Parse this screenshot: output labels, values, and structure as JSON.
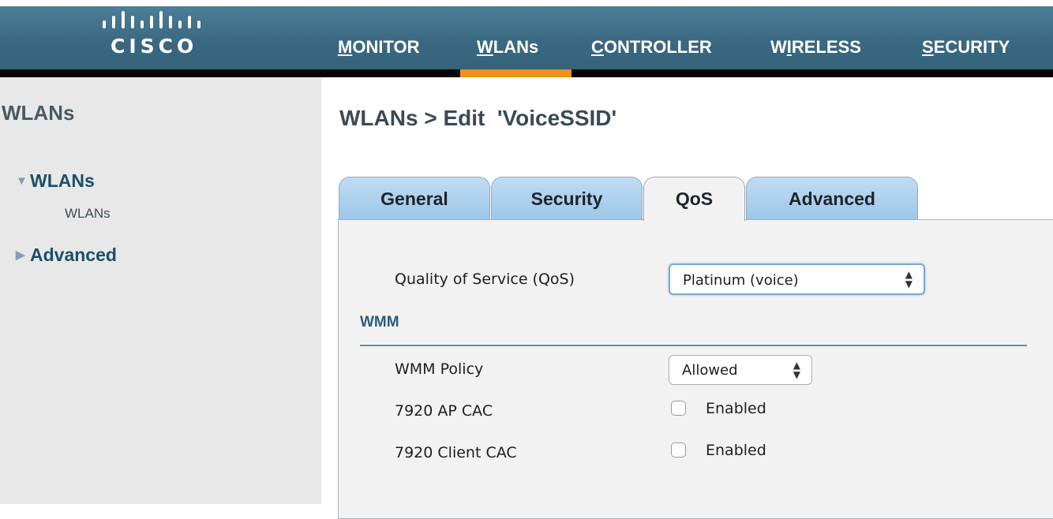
{
  "brand": {
    "logo_text": "CISCO"
  },
  "nav": {
    "monitor": {
      "ul": "M",
      "rest": "ONITOR"
    },
    "wlans": {
      "ul": "W",
      "rest": "LANs"
    },
    "controller": {
      "ul": "C",
      "rest": "ONTROLLER"
    },
    "wireless": {
      "pre": "W",
      "ul": "I",
      "rest": "RELESS"
    },
    "security": {
      "ul": "S",
      "rest": "ECURITY"
    },
    "active": "WLANs"
  },
  "sidebar": {
    "title": "WLANs",
    "items": [
      {
        "label": "WLANs",
        "expanded": true,
        "sub": "WLANs"
      },
      {
        "label": "Advanced",
        "expanded": false
      }
    ]
  },
  "page": {
    "title": "WLANs > Edit  'VoiceSSID'"
  },
  "tabs": [
    "General",
    "Security",
    "QoS",
    "Advanced"
  ],
  "active_tab": "QoS",
  "qos": {
    "label": "Quality of Service (QoS)",
    "value": "Platinum (voice)"
  },
  "wmm": {
    "section_label": "WMM",
    "policy_label": "WMM Policy",
    "policy_value": "Allowed",
    "ap_cac_label": "7920 AP CAC",
    "ap_cac_checkbox": "Enabled",
    "client_cac_label": "7920 Client CAC",
    "client_cac_checkbox": "Enabled"
  },
  "colors": {
    "banner": "#3a6880",
    "active_tab_underline": "#f0921e",
    "tab_blue": "#9cc6e8",
    "sidebar_bg": "#e8e8e8",
    "section_text": "#275e7c"
  }
}
